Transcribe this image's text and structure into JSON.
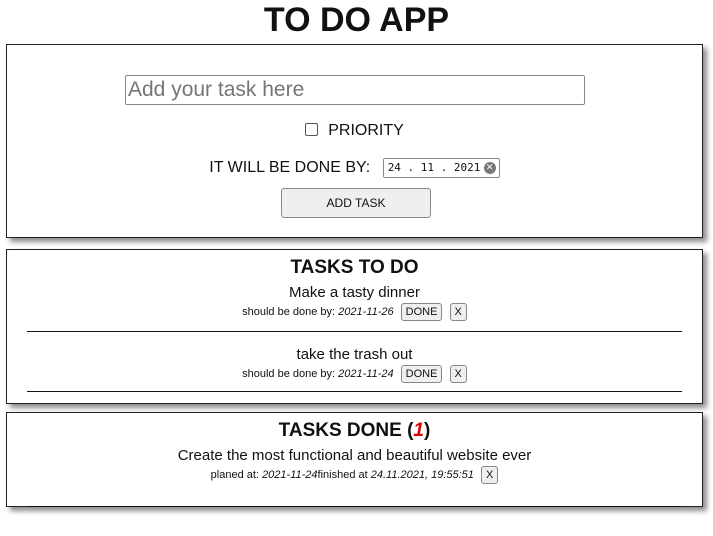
{
  "app": {
    "title": "TO DO APP"
  },
  "add_form": {
    "task_placeholder": "Add your task here",
    "priority_label": "PRIORITY",
    "priority_checked": false,
    "deadline_label": "IT WILL BE DONE BY:",
    "deadline_value": "24 . 11 . 2021",
    "add_button_label": "ADD TASK"
  },
  "todo": {
    "title": "TASKS TO DO",
    "due_prefix": "should be done by:",
    "done_button_label": "DONE",
    "remove_button_label": "X",
    "items": [
      {
        "name": "Make a tasty dinner",
        "due": "2021-11-26"
      },
      {
        "name": "take the trash out",
        "due": "2021-11-24"
      }
    ]
  },
  "done": {
    "title_prefix": "TASKS DONE (",
    "count": "1",
    "title_suffix": ")",
    "planned_prefix": "planed at:",
    "finished_prefix": "finished at",
    "remove_button_label": "X",
    "items": [
      {
        "name": "Create the most functional and beautiful website ever",
        "planned": "2021-11-24",
        "finished": "24.11.2021, 19:55:51"
      }
    ]
  }
}
